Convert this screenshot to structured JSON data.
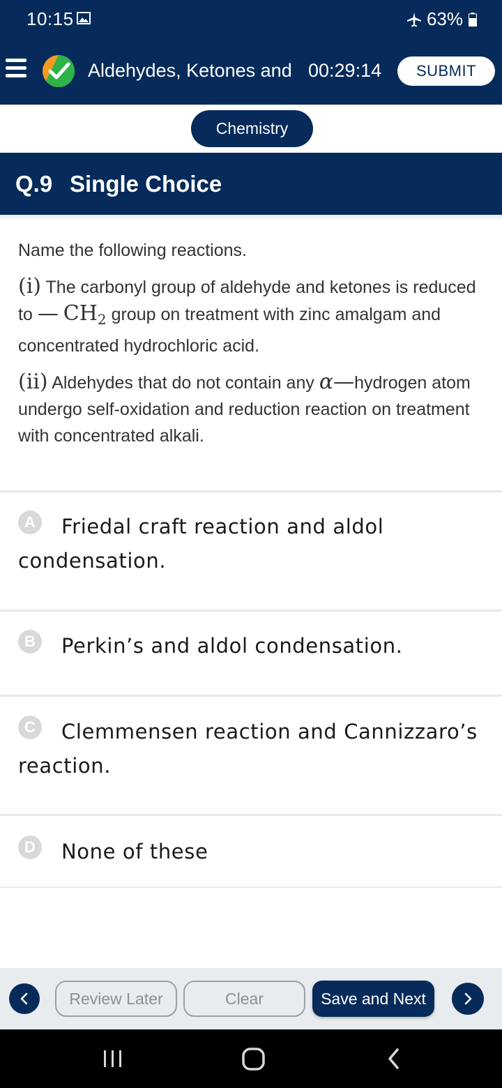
{
  "status_bar": {
    "time": "10:15",
    "battery": "63%"
  },
  "header": {
    "title": "Aldehydes, Ketones and",
    "timer": "00:29:14",
    "submit_label": "SUBMIT"
  },
  "subject": {
    "label": "Chemistry"
  },
  "question": {
    "number": "Q.9",
    "type": "Single Choice",
    "intro": "Name the following reactions.",
    "part1": {
      "marker": "(i)",
      "text_a": "The carbonyl group of aldehyde and ketones is reduced to",
      "dash": "—",
      "formula_main": "CH",
      "formula_sub": "2",
      "text_b": "group on treatment with zinc amalgam and concentrated hydrochloric acid."
    },
    "part2": {
      "marker": "(ii)",
      "text_a": "Aldehydes that do not contain any",
      "alpha": "α",
      "dash": "—",
      "text_b": "hydrogen atom undergo self-oxidation and reduction reaction on treatment with concentrated alkali."
    }
  },
  "options": [
    {
      "letter": "A",
      "text": "Friedal craft reaction and aldol condensation."
    },
    {
      "letter": "B",
      "text": "Perkin’s and aldol condensation."
    },
    {
      "letter": "C",
      "text": "Clemmensen reaction and Cannizzaro’s reaction."
    },
    {
      "letter": "D",
      "text": "None of these"
    }
  ],
  "actions": {
    "review_label": "Review Later",
    "clear_label": "Clear",
    "save_next_label": "Save and Next"
  },
  "colors": {
    "primary": "#062b5a",
    "option_badge": "#d9d9d9",
    "action_bar_bg": "#e9ecef"
  },
  "icons": {
    "status": [
      "gallery-icon",
      "airplane-icon",
      "battery-icon"
    ],
    "header": [
      "menu-icon",
      "logo-check-icon"
    ],
    "nav": [
      "prev-arrow-icon",
      "next-arrow-icon"
    ],
    "system": [
      "recents-icon",
      "home-icon",
      "back-icon"
    ]
  }
}
